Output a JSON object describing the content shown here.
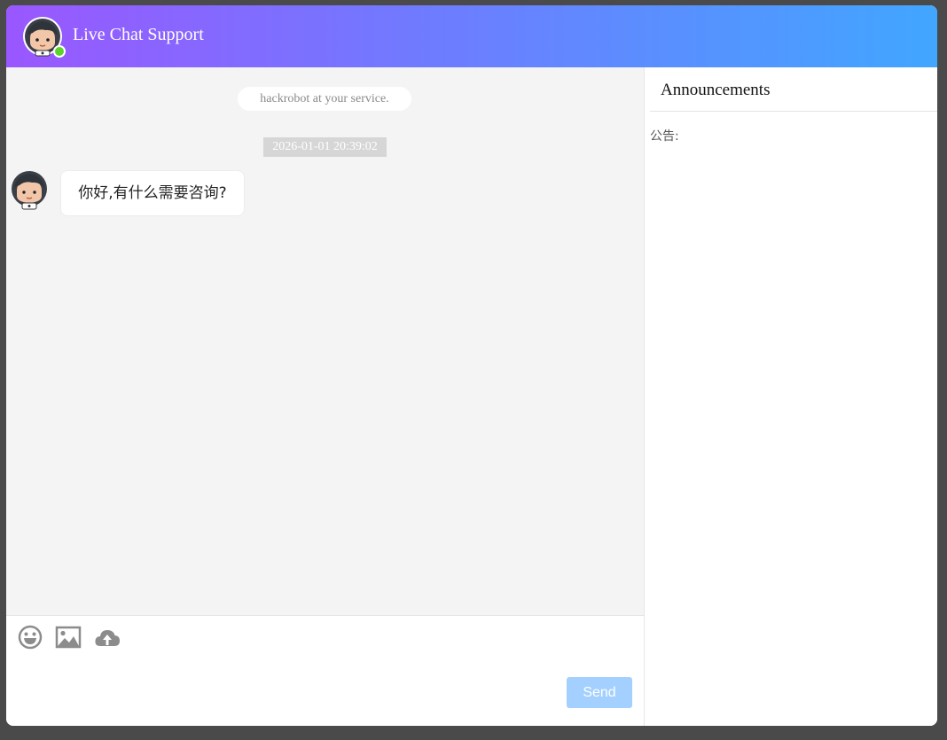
{
  "header": {
    "title": "Live Chat Support",
    "avatar_icon": "robot-avatar-icon",
    "status": "online",
    "gradient": [
      "#9a57ff",
      "#41a6ff"
    ]
  },
  "chat": {
    "service_notice": "hackrobot at your service.",
    "messages": [
      {
        "timestamp": "2026-01-01 20:39:02",
        "sender": "robot",
        "text": "你好,有什么需要咨询?"
      }
    ]
  },
  "composer": {
    "tools": [
      "emoji-icon",
      "image-icon",
      "upload-cloud-icon"
    ],
    "send_label": "Send",
    "send_color": "#a4d0ff"
  },
  "sidebar": {
    "title": "Announcements",
    "notice_label": "公告:"
  }
}
